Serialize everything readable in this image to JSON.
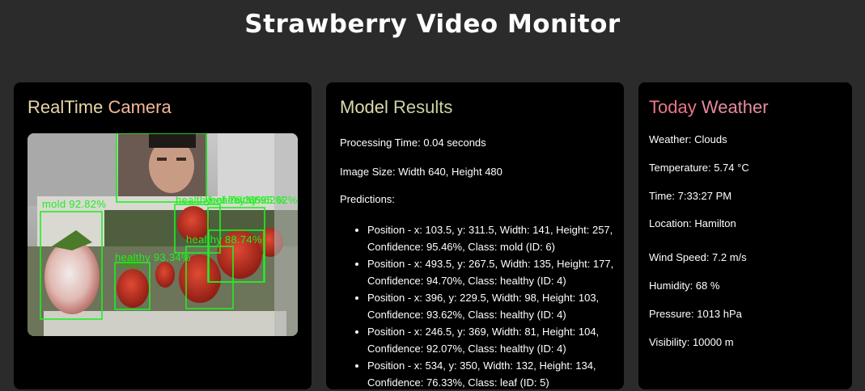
{
  "page": {
    "title": "Strawberry Video Monitor"
  },
  "camera": {
    "title_part1": "RealTime",
    "title_part2": "Camera",
    "detections": [
      {
        "label": "mold 92.82%"
      },
      {
        "label": "healthy 93.34%"
      },
      {
        "label": "healthy 88.74%"
      },
      {
        "label": "healthy"
      },
      {
        "label": "healthy 86.62%"
      },
      {
        "label": "leaf 76.33%"
      },
      {
        "label": "healthy 95.62%"
      }
    ]
  },
  "model": {
    "title_part1": "Model",
    "title_part2": "Results",
    "processing_time": "Processing Time: 0.04 seconds",
    "image_size": "Image Size: Width 640, Height 480",
    "predictions_label": "Predictions:",
    "predictions": [
      "Position - x: 103.5, y: 311.5, Width: 141, Height: 257, Confidence: 95.46%, Class: mold (ID: 6)",
      "Position - x: 493.5, y: 267.5, Width: 135, Height: 177, Confidence: 94.70%, Class: healthy (ID: 4)",
      "Position - x: 396, y: 229.5, Width: 98, Height: 103, Confidence: 93.62%, Class: healthy (ID: 4)",
      "Position - x: 246.5, y: 369, Width: 81, Height: 104, Confidence: 92.07%, Class: healthy (ID: 4)",
      "Position - x: 534, y: 350, Width: 132, Height: 134, Confidence: 76.33%, Class: leaf (ID: 5)"
    ]
  },
  "weather": {
    "title_part1": "Today",
    "title_part2": "Weather",
    "weather": "Weather: Clouds",
    "temperature": "Temperature: 5.74 °C",
    "time": "Time: 7:33:27 PM",
    "location": "Location: Hamilton",
    "wind_speed": "Wind Speed: 7.2 m/s",
    "humidity": "Humidity: 68 %",
    "pressure": "Pressure: 1013 hPa",
    "visibility": "Visibility: 10000 m"
  },
  "colors": {
    "page_bg": "#2b2b2b",
    "card_bg": "#000000",
    "camera_title_a": "#e8d6a8",
    "camera_title_b": "#f2b89a",
    "model_title_a": "#dcdcae",
    "model_title_b": "#c9d3a5",
    "weather_title_a": "#e9768a",
    "weather_title_b": "#e58aa0",
    "detection": "#22ee22"
  }
}
